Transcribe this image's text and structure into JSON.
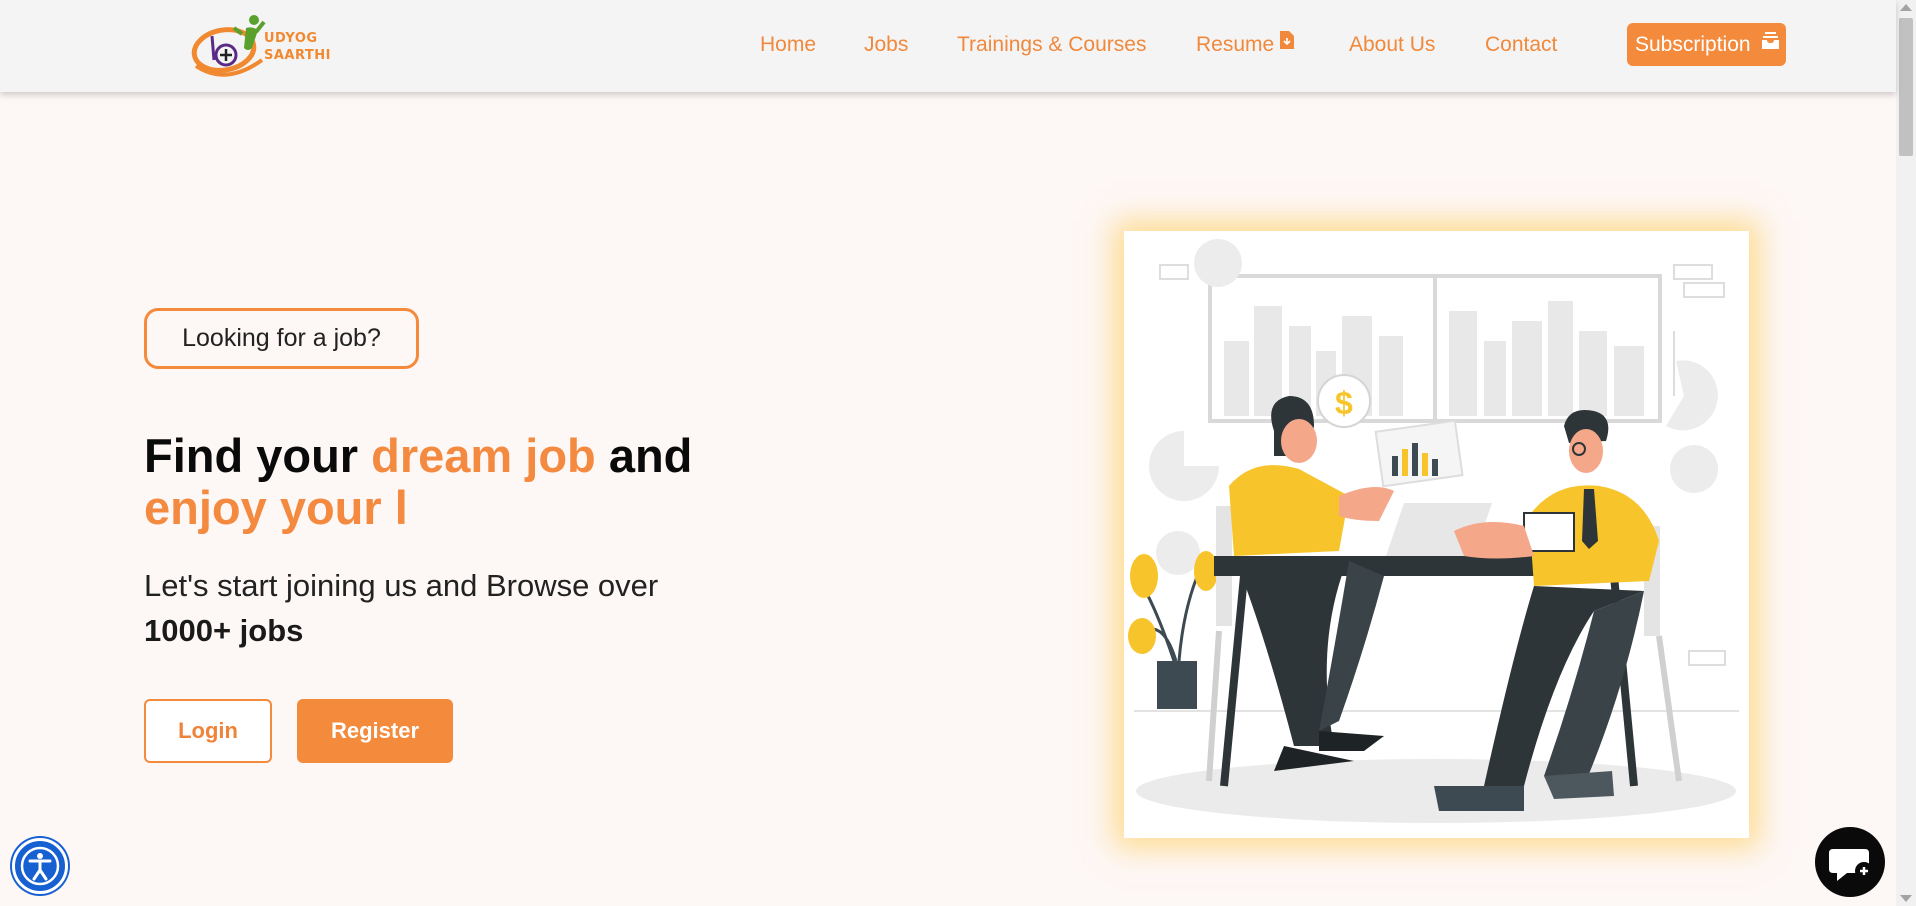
{
  "brand": {
    "line1": "UDYOG",
    "line2": "SAARTHI",
    "logo_icon": "wheelchair-person-logo"
  },
  "nav": {
    "items": [
      {
        "label": "Home"
      },
      {
        "label": "Jobs"
      },
      {
        "label": "Trainings & Courses"
      },
      {
        "label": "Resume",
        "icon": "document-download-icon"
      },
      {
        "label": "About Us"
      },
      {
        "label": "Contact"
      }
    ],
    "subscription": {
      "label": "Subscription",
      "icon": "inbox-stack-icon"
    }
  },
  "hero": {
    "tag": "Looking for a job?",
    "headline": {
      "part1": "Find your ",
      "highlight1": "dream job",
      "part2": " and",
      "highlight2": "enjoy your l"
    },
    "subtext": "Let's start joining us and Browse over",
    "subtext_bold": "1000+ jobs",
    "login_label": "Login",
    "register_label": "Register"
  },
  "floating": {
    "accessibility_icon": "accessibility-icon",
    "chat_icon": "chat-bubble-icon"
  },
  "colors": {
    "accent": "#f48a3b",
    "illustration_yellow": "#f7c52b",
    "dark": "#2e3539",
    "background": "#fdf7f6"
  }
}
